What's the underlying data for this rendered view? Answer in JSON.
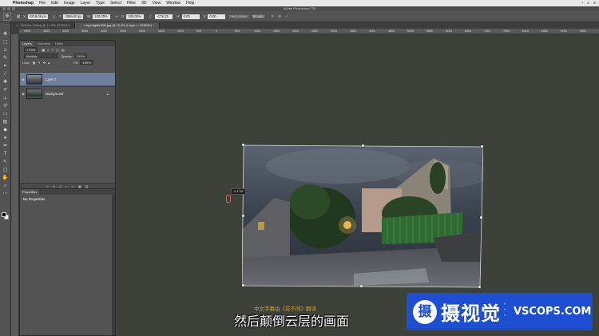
{
  "menubar": {
    "app_name": "Photoshop",
    "items": [
      "File",
      "Edit",
      "Image",
      "Layer",
      "Type",
      "Select",
      "Filter",
      "3D",
      "View",
      "Window",
      "Help"
    ]
  },
  "window": {
    "title": "Adobe Photoshop CS6"
  },
  "options_bar": {
    "x_label": "X:",
    "x_value": "5218,08 px",
    "y_label": "Y:",
    "y_value": "1859,00 px",
    "w_label": "W:",
    "w_value": "100,00%",
    "h_label": "H:",
    "h_value": "100,00%",
    "angle_value": "-178,15",
    "h_skew_label": "H:",
    "h_skew_value": "0,00",
    "v_skew_label": "V:",
    "v_skew_value": "0,00",
    "interpolation_label": "Interpolation:",
    "interpolation_value": "Bicubic"
  },
  "tabs": [
    {
      "label": "CielGris-Ruling @ 12,5% (RGB/8*)",
      "active": false
    },
    {
      "label": "LapinAgileHDR.jpg @ 12,5% (Layer 1, RGB/8*) *",
      "active": true
    }
  ],
  "ruler_top": [
    "5000",
    "4500",
    "4000",
    "3500",
    "3000",
    "2500",
    "2000",
    "1500",
    "1000",
    "500",
    "0",
    "500",
    "1000",
    "1500",
    "2000",
    "2500",
    "3000",
    "3500",
    "4000",
    "4500",
    "5000",
    "5500",
    "6000",
    "6500",
    "7000",
    "7500",
    "8000",
    "8500",
    "9000",
    "9500"
  ],
  "layers_panel": {
    "tabs": [
      "Layers",
      "Channels",
      "Paths"
    ],
    "kind_label": "Kind",
    "blend_mode": "Multiply",
    "opacity_label": "Opacity:",
    "opacity_value": "100%",
    "lock_label": "Lock:",
    "fill_label": "Fill:",
    "fill_value": "100%",
    "layers": [
      {
        "name": "Layer 1",
        "selected": true
      },
      {
        "name": "Background",
        "selected": false
      }
    ]
  },
  "properties_panel": {
    "title": "Properties",
    "body": "No Properties"
  },
  "transform_readout": "-0.1°/N°",
  "subtitles": {
    "small": "中文字幕由《花不同》翻译",
    "main": "然后颠倒云层的画面"
  },
  "watermark": {
    "logo_char": "摄",
    "name": "摄视觉",
    "domain": "VSCOPS.COM"
  }
}
